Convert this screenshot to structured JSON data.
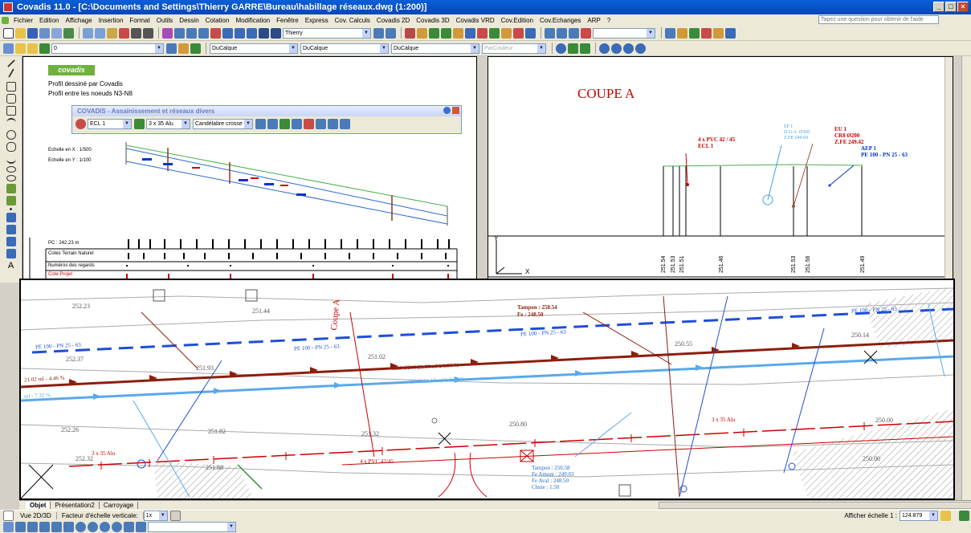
{
  "window": {
    "title": "Covadis 11.0 - [C:\\Documents and Settings\\Thierry GARRE\\Bureau\\habillage réseaux.dwg (1:200)]"
  },
  "menu": {
    "items": [
      "Fichier",
      "Edition",
      "Affichage",
      "Insertion",
      "Format",
      "Outils",
      "Dessin",
      "Cotation",
      "Modification",
      "Fenêtre",
      "Express",
      "Cov. Calculs",
      "Covadis 2D",
      "Covadis 3D",
      "Covadis VRD",
      "Cov.Edition",
      "Cov.Echanges",
      "ARP",
      "?"
    ],
    "help_placeholder": "Tapez une question pour obtenir de l'aide"
  },
  "toolbar1": {
    "user_combo": "Thierry"
  },
  "toolbar2": {
    "layer_combo": "0",
    "color_combo": "DuCalque",
    "linetype_combo": "DuCalque",
    "lineweight_combo": "DuCalque",
    "plotstyle_combo": "ParCouleur"
  },
  "profile_view": {
    "logo": "covadis",
    "note1": "Profil dessiné par Covadis",
    "note2": "Profil entre les noeuds N3-N8",
    "float_toolbar": {
      "title": "COVADIS - Assainissement et réseaux divers",
      "combo1": "ECL 1",
      "combo2": "3 x 35 Alu",
      "combo3": "Candélabre crosse"
    },
    "scale_x": "Echelle en X : 1/500",
    "scale_y": "Echelle en Y : 1/100",
    "pc": "PC : 242.23 m",
    "row1": "Cotes Terrain Naturel",
    "row2": "Numéros des regards",
    "row3": "Cote Projet"
  },
  "section_view": {
    "title": "COUPE A",
    "label_red1": [
      "4 x PVC 42 / 45",
      "ECL 1"
    ],
    "label_lblue": [
      "EP 1",
      "D.G.A. Ø300",
      "Z.FE 249.69"
    ],
    "label_red2": [
      "EU 1",
      "CR8 Ø200",
      "Z.FE 249.42"
    ],
    "label_blue": [
      "AEP 1",
      "PE 100 - PN 25 - 63"
    ],
    "elevations": [
      "251.54",
      "251.53",
      "251.51",
      "251.46",
      "251.53",
      "251.56",
      "251.49"
    ],
    "axis_x": "X",
    "axis_y": "Y"
  },
  "plan_view": {
    "spot_heights": [
      "252.23",
      "252.37",
      "251.93",
      "252.26",
      "251.82",
      "252.32",
      "251.88",
      "251.44",
      "251.02",
      "250.14",
      "250.55",
      "250.00",
      "250.80",
      "251.32",
      "250.00"
    ],
    "aep_labels": [
      "PE 100 - PN 25 - 63",
      "PE 100 - PN 25 - 63",
      "PE 100 - PN 25 - 63",
      "PE 100 - PN 25 - 63"
    ],
    "eu_label": "CR8 Ø200 21.06 ml à 1.56 %",
    "eu_label2": "21.02 ml - 4.46 %",
    "ep_label": "Ø300 21.17 ml à 2.53 %",
    "ep_label2": "ml - 7.32 %",
    "coupe_label": "Coupe A",
    "elec_label": "3 x 35 Alu",
    "elec_label2": "3 x 35 Alu",
    "pvc_label": "4 x PVC 42/45",
    "tampon1": [
      "Tampon : 258.54",
      "Fe : 248.50"
    ],
    "tampon2": [
      "Tampon : 250.58",
      "Fe Amont : 249.03",
      "Fe Aval : 248.50",
      "Chute : 1.50"
    ]
  },
  "tabs": [
    "Objet",
    "Présentation2",
    "Carroyage"
  ],
  "status": {
    "vue": "Vue 2D/3D",
    "facteur_label": "Facteur d'échelle verticale:",
    "facteur_value": "1x",
    "echelle_label": "Afficher échelle 1 :",
    "echelle_value": "124.879"
  }
}
